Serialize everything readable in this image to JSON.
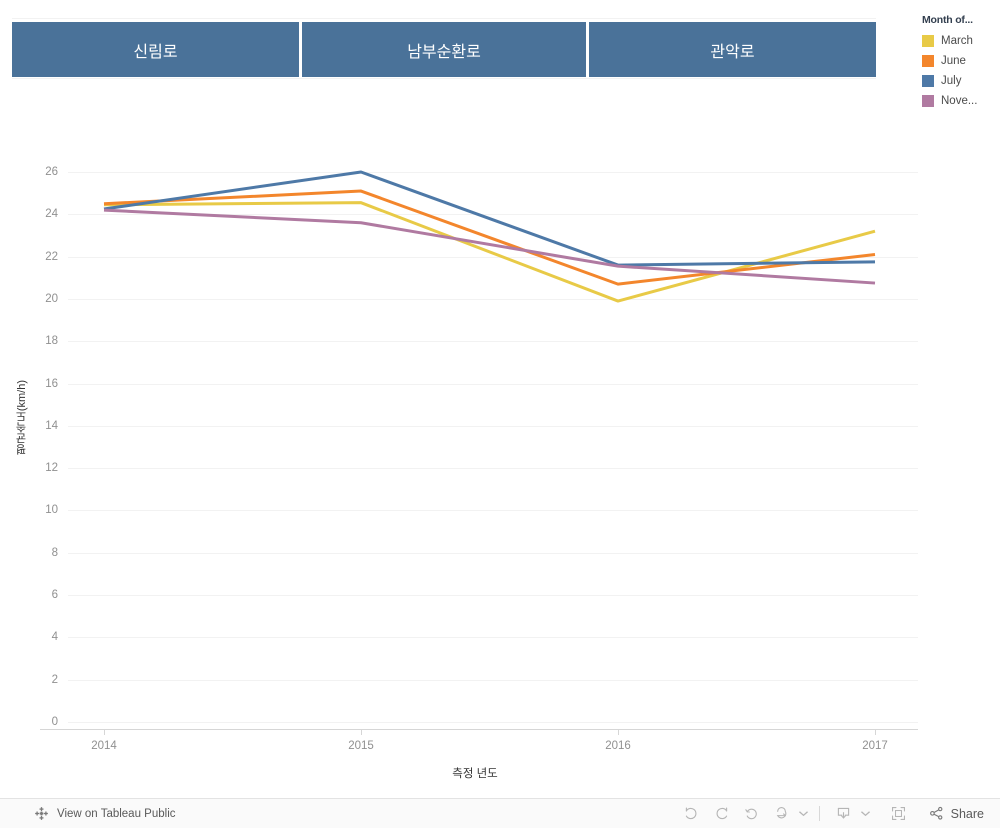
{
  "columns": [
    {
      "label": "신림로"
    },
    {
      "label": "남부순환로"
    },
    {
      "label": "관악로"
    }
  ],
  "legend": {
    "title": "Month of...",
    "items": [
      {
        "label": "March",
        "color": "#e8ca47"
      },
      {
        "label": "June",
        "color": "#f3862c"
      },
      {
        "label": "July",
        "color": "#4e79a7"
      },
      {
        "label": "Nove...",
        "color": "#b07aa1"
      }
    ]
  },
  "chart_data": {
    "type": "line",
    "title": "",
    "xlabel": "측정 년도",
    "ylabel": "평균속도(km/h)",
    "x": [
      "2014",
      "2015",
      "2016",
      "2017"
    ],
    "xticks": [
      "2014",
      "2015",
      "2016",
      "2017"
    ],
    "yticks": [
      0,
      2,
      4,
      6,
      8,
      10,
      12,
      14,
      16,
      18,
      20,
      22,
      24,
      26
    ],
    "ylim": [
      0,
      26
    ],
    "grid": "horizontal",
    "legend_position": "right",
    "series": [
      {
        "name": "March",
        "color": "#e8ca47",
        "values": [
          24.45,
          24.55,
          19.9,
          23.2
        ]
      },
      {
        "name": "June",
        "color": "#f3862c",
        "values": [
          24.5,
          25.1,
          20.7,
          22.1
        ]
      },
      {
        "name": "July",
        "color": "#4e79a7",
        "values": [
          24.25,
          26.0,
          21.6,
          21.75
        ]
      },
      {
        "name": "November",
        "color": "#b07aa1",
        "values": [
          24.2,
          23.6,
          21.55,
          20.75
        ]
      }
    ]
  },
  "toolbar": {
    "tableau_link": "View on Tableau Public",
    "share_label": "Share",
    "buttons": [
      {
        "name": "undo",
        "title": "Undo"
      },
      {
        "name": "redo",
        "title": "Redo"
      },
      {
        "name": "revert",
        "title": "Revert"
      },
      {
        "name": "refresh",
        "title": "Refresh"
      },
      {
        "name": "pause",
        "title": "Pause"
      },
      {
        "name": "download",
        "title": "Download"
      },
      {
        "name": "fullscreen",
        "title": "Full Screen"
      }
    ]
  },
  "colors": {
    "header_band": "#4a7299",
    "gridline": "#f2f2f2",
    "axis": "#d6d6d6",
    "tick_text": "#909090",
    "axis_title": "#333333",
    "toolbar_bg": "#fafafa"
  }
}
